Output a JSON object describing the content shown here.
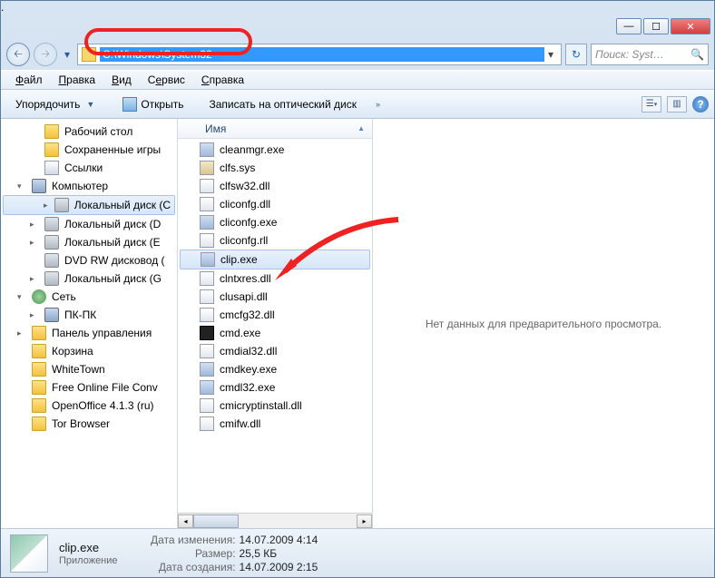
{
  "address_path": "C:\\Windows\\System32",
  "search_placeholder": "Поиск: Syst…",
  "menu": {
    "file": "Файл",
    "edit": "Правка",
    "view": "Вид",
    "tools": "Сервис",
    "help": "Справка"
  },
  "toolbar": {
    "organize": "Упорядочить",
    "open": "Открыть",
    "burn": "Записать на оптический диск"
  },
  "column_header": "Имя",
  "preview_msg": "Нет данных для предварительного просмотра.",
  "sidebar": [
    {
      "label": "Рабочий стол",
      "ic": "ic-folder",
      "lvl": "t2",
      "tri": ""
    },
    {
      "label": "Сохраненные игры",
      "ic": "ic-folder",
      "lvl": "t2",
      "tri": ""
    },
    {
      "label": "Ссылки",
      "ic": "ic-link",
      "lvl": "t2",
      "tri": ""
    },
    {
      "label": "Компьютер",
      "ic": "ic-comp",
      "lvl": "",
      "tri": "▾"
    },
    {
      "label": "Локальный диск (С",
      "ic": "ic-drive",
      "lvl": "t2",
      "tri": "▸",
      "sel": true
    },
    {
      "label": "Локальный диск (D",
      "ic": "ic-drive",
      "lvl": "t2",
      "tri": "▸"
    },
    {
      "label": "Локальный диск (E",
      "ic": "ic-drive",
      "lvl": "t2",
      "tri": "▸"
    },
    {
      "label": "DVD RW дисковод (",
      "ic": "ic-drive",
      "lvl": "t2",
      "tri": ""
    },
    {
      "label": "Локальный диск (G",
      "ic": "ic-drive",
      "lvl": "t2",
      "tri": "▸"
    },
    {
      "label": "Сеть",
      "ic": "ic-net",
      "lvl": "",
      "tri": "▾"
    },
    {
      "label": "ПК-ПК",
      "ic": "ic-comp",
      "lvl": "t2",
      "tri": "▸"
    },
    {
      "label": "Панель управления",
      "ic": "ic-folder",
      "lvl": "",
      "tri": "▸"
    },
    {
      "label": "Корзина",
      "ic": "ic-folder",
      "lvl": "",
      "tri": ""
    },
    {
      "label": "WhiteTown",
      "ic": "ic-folder",
      "lvl": "",
      "tri": ""
    },
    {
      "label": "Free Online File Conv",
      "ic": "ic-folder",
      "lvl": "",
      "tri": ""
    },
    {
      "label": "OpenOffice 4.1.3 (ru)",
      "ic": "ic-folder",
      "lvl": "",
      "tri": ""
    },
    {
      "label": "Tor Browser",
      "ic": "ic-folder",
      "lvl": "",
      "tri": ""
    }
  ],
  "files": [
    {
      "name": "cleanmgr.exe",
      "ic": "exe"
    },
    {
      "name": "clfs.sys",
      "ic": "sys"
    },
    {
      "name": "clfsw32.dll",
      "ic": "dll"
    },
    {
      "name": "cliconfg.dll",
      "ic": "dll"
    },
    {
      "name": "cliconfg.exe",
      "ic": "exe"
    },
    {
      "name": "cliconfg.rll",
      "ic": "dll"
    },
    {
      "name": "clip.exe",
      "ic": "exe",
      "sel": true
    },
    {
      "name": "clntxres.dll",
      "ic": "dll"
    },
    {
      "name": "clusapi.dll",
      "ic": "dll"
    },
    {
      "name": "cmcfg32.dll",
      "ic": "dll"
    },
    {
      "name": "cmd.exe",
      "ic": "cmd"
    },
    {
      "name": "cmdial32.dll",
      "ic": "dll"
    },
    {
      "name": "cmdkey.exe",
      "ic": "exe"
    },
    {
      "name": "cmdl32.exe",
      "ic": "exe"
    },
    {
      "name": "cmicryptinstall.dll",
      "ic": "dll"
    },
    {
      "name": "cmifw.dll",
      "ic": "dll"
    }
  ],
  "status": {
    "filename": "clip.exe",
    "filetype": "Приложение",
    "modified_lbl": "Дата изменения:",
    "modified_val": "14.07.2009 4:14",
    "size_lbl": "Размер:",
    "size_val": "25,5 КБ",
    "created_lbl": "Дата создания:",
    "created_val": "14.07.2009 2:15"
  }
}
